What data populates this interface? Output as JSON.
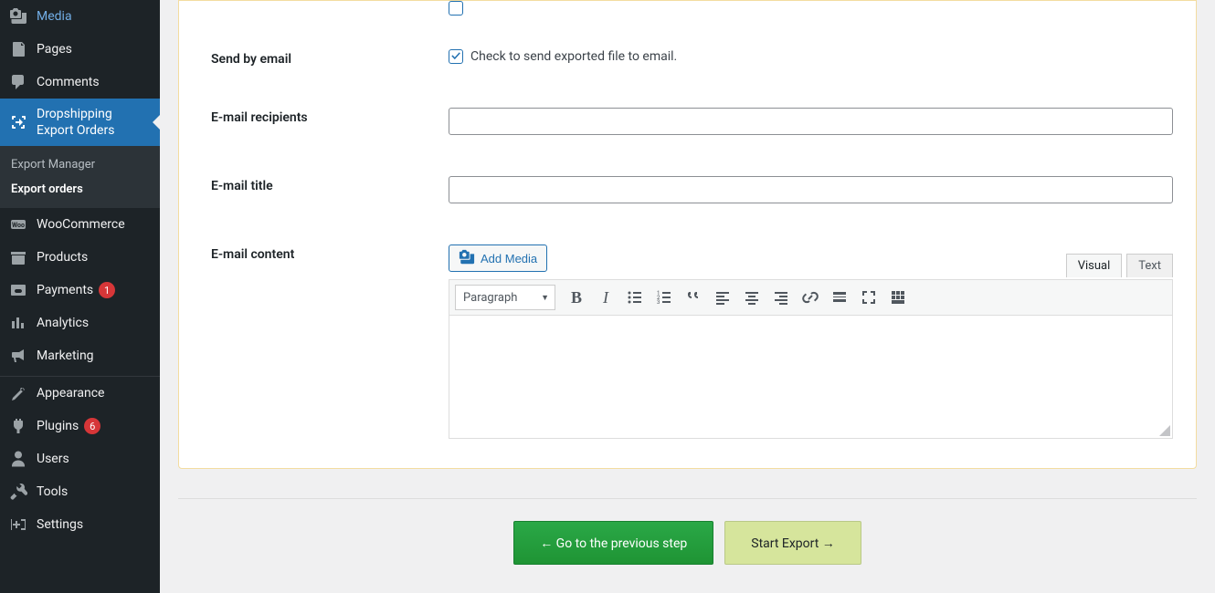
{
  "sidebar": {
    "items": [
      {
        "key": "media",
        "label": "Media"
      },
      {
        "key": "pages",
        "label": "Pages"
      },
      {
        "key": "comments",
        "label": "Comments"
      },
      {
        "key": "dropshipping",
        "label": "Dropshipping Export Orders",
        "current": true,
        "submenu": [
          {
            "label": "Export Manager",
            "active": false
          },
          {
            "label": "Export orders",
            "active": true
          }
        ]
      },
      {
        "key": "woocommerce",
        "label": "WooCommerce"
      },
      {
        "key": "products",
        "label": "Products"
      },
      {
        "key": "payments",
        "label": "Payments",
        "badge": "1"
      },
      {
        "key": "analytics",
        "label": "Analytics"
      },
      {
        "key": "marketing",
        "label": "Marketing"
      },
      {
        "key": "appearance",
        "label": "Appearance"
      },
      {
        "key": "plugins",
        "label": "Plugins",
        "badge": "6"
      },
      {
        "key": "users",
        "label": "Users"
      },
      {
        "key": "tools",
        "label": "Tools"
      },
      {
        "key": "settings",
        "label": "Settings"
      }
    ]
  },
  "form": {
    "send_by_email": {
      "label": "Send by email",
      "help": "Check to send exported file to email.",
      "checked": true
    },
    "email_recipients": {
      "label": "E-mail recipients",
      "value": ""
    },
    "email_title": {
      "label": "E-mail title",
      "value": ""
    },
    "email_content": {
      "label": "E-mail content"
    }
  },
  "editor": {
    "add_media": "Add Media",
    "tabs": {
      "visual": "Visual",
      "text": "Text"
    },
    "format_select": "Paragraph"
  },
  "buttons": {
    "prev": "← Go to the previous step",
    "start": "Start Export →"
  }
}
